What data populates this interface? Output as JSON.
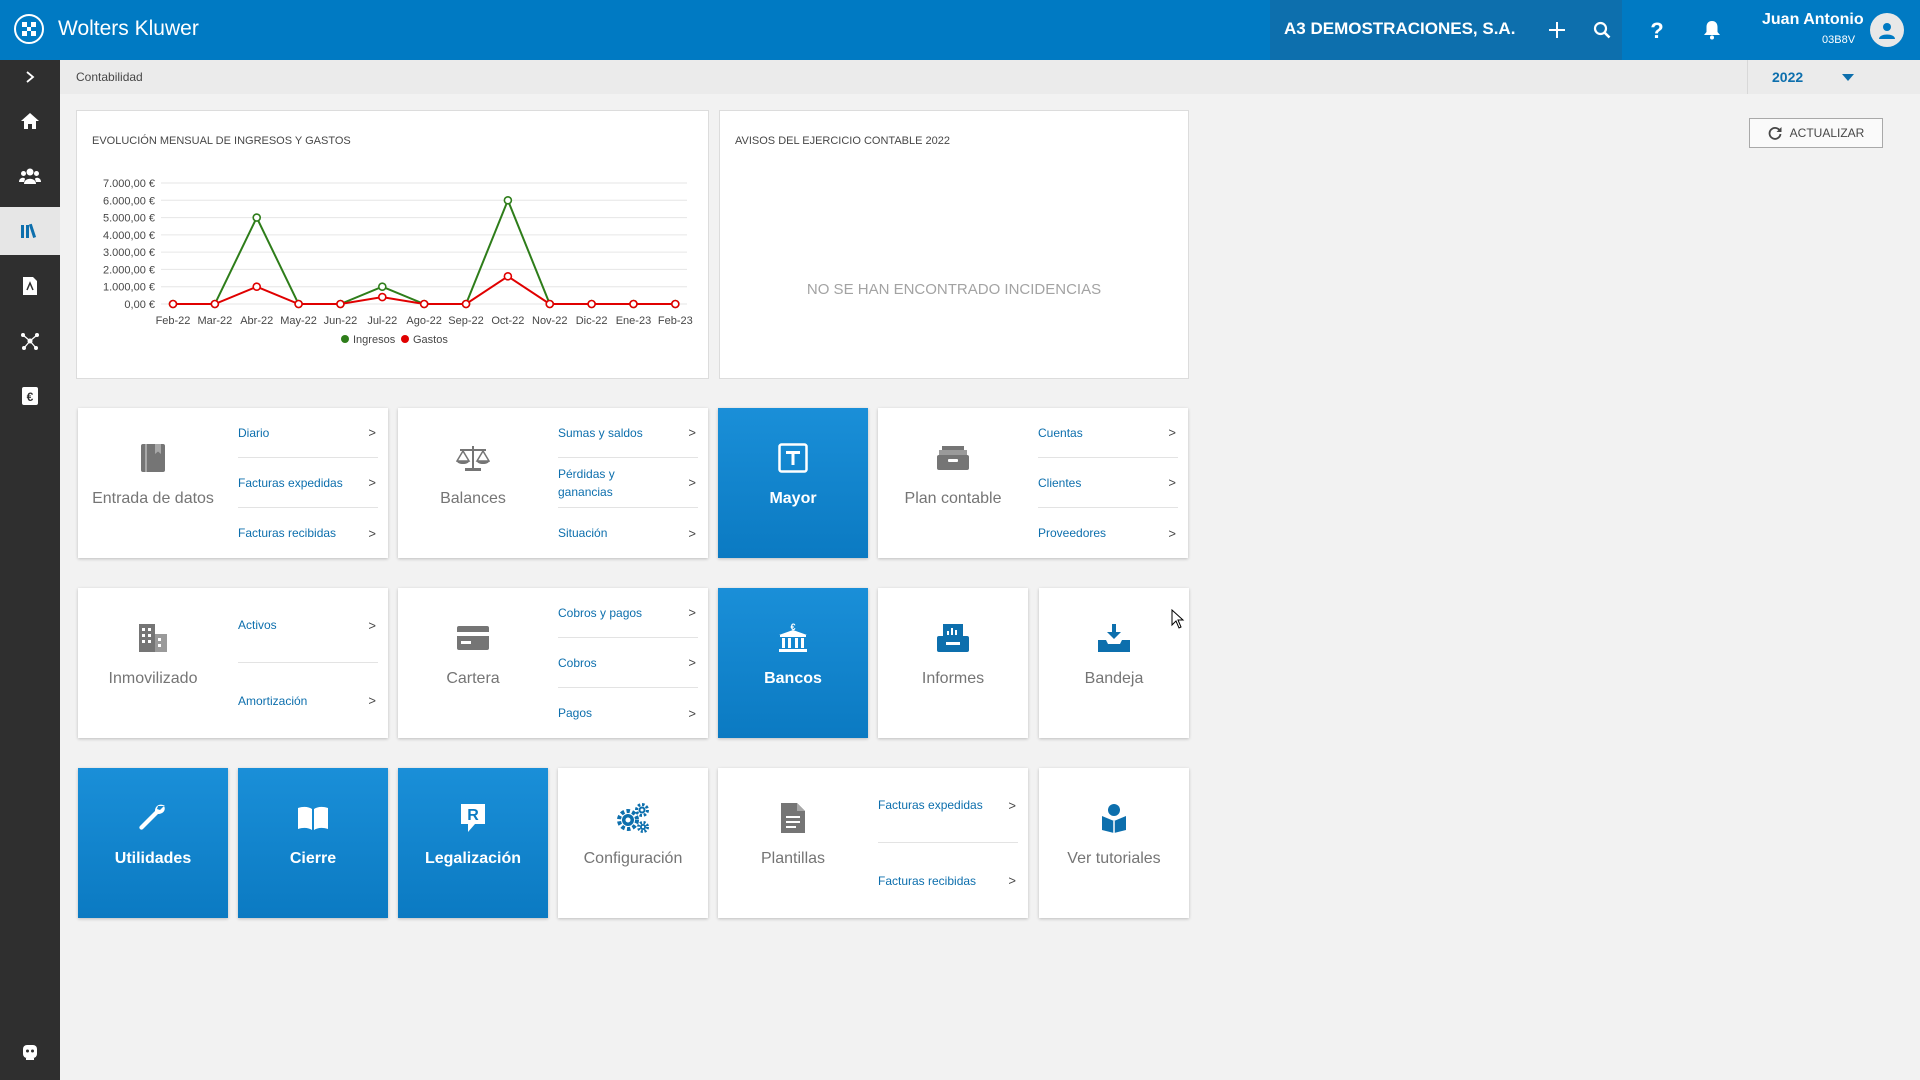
{
  "app": {
    "brand": "Wolters Kluwer"
  },
  "header": {
    "company": "A3 DEMOSTRACIONES, S.A.",
    "user_name": "Juan Antonio",
    "user_code": "03B8V"
  },
  "breadcrumb": "Contabilidad",
  "year": "2022",
  "refresh_label": "ACTUALIZAR",
  "chart_panel": {
    "title": "EVOLUCIÓN MENSUAL DE INGRESOS Y GASTOS"
  },
  "notices_panel": {
    "title": "AVISOS DEL EJERCICIO CONTABLE 2022",
    "empty_text": "NO SE HAN ENCONTRADO INCIDENCIAS"
  },
  "chart_data": {
    "type": "line",
    "title": "EVOLUCIÓN MENSUAL DE INGRESOS Y GASTOS",
    "xlabel": "",
    "ylabel": "",
    "ylim": [
      0,
      7000
    ],
    "yticks": [
      "0,00 €",
      "1.000,00 €",
      "2.000,00 €",
      "3.000,00 €",
      "4.000,00 €",
      "5.000,00 €",
      "6.000,00 €",
      "7.000,00 €"
    ],
    "categories": [
      "Feb-22",
      "Mar-22",
      "Abr-22",
      "May-22",
      "Jun-22",
      "Jul-22",
      "Ago-22",
      "Sep-22",
      "Oct-22",
      "Nov-22",
      "Dic-22",
      "Ene-23",
      "Feb-23"
    ],
    "series": [
      {
        "name": "Ingresos",
        "color": "#2e7d1a",
        "values": [
          0,
          0,
          5000,
          0,
          0,
          1000,
          0,
          0,
          6000,
          0,
          0,
          0,
          0
        ]
      },
      {
        "name": "Gastos",
        "color": "#e00000",
        "values": [
          0,
          0,
          1000,
          0,
          0,
          400,
          0,
          0,
          1600,
          0,
          0,
          0,
          0
        ]
      }
    ],
    "grid": true,
    "legend": "bottom"
  },
  "tiles": {
    "entrada": {
      "label": "Entrada de datos",
      "links": [
        "Diario",
        "Facturas expedidas",
        "Facturas recibidas"
      ]
    },
    "balances": {
      "label": "Balances",
      "links": [
        "Sumas y saldos",
        "Pérdidas y ganancias",
        "Situación"
      ]
    },
    "mayor": {
      "label": "Mayor"
    },
    "plan": {
      "label": "Plan contable",
      "links": [
        "Cuentas",
        "Clientes",
        "Proveedores"
      ]
    },
    "inmovilizado": {
      "label": "Inmovilizado",
      "links": [
        "Activos",
        "Amortización"
      ]
    },
    "cartera": {
      "label": "Cartera",
      "links": [
        "Cobros y pagos",
        "Cobros",
        "Pagos"
      ]
    },
    "bancos": {
      "label": "Bancos"
    },
    "informes": {
      "label": "Informes"
    },
    "bandeja": {
      "label": "Bandeja"
    },
    "utilidades": {
      "label": "Utilidades"
    },
    "cierre": {
      "label": "Cierre"
    },
    "legalizacion": {
      "label": "Legalización"
    },
    "configuracion": {
      "label": "Configuración"
    },
    "plantillas": {
      "label": "Plantillas",
      "links": [
        "Facturas expedidas",
        "Facturas recibidas"
      ]
    },
    "tutoriales": {
      "label": "Ver tutoriales"
    }
  },
  "chevron": ">",
  "colors": {
    "brand_blue": "#007ac3",
    "sidebar": "#2f2f2f",
    "link_blue": "#0d6fad"
  }
}
